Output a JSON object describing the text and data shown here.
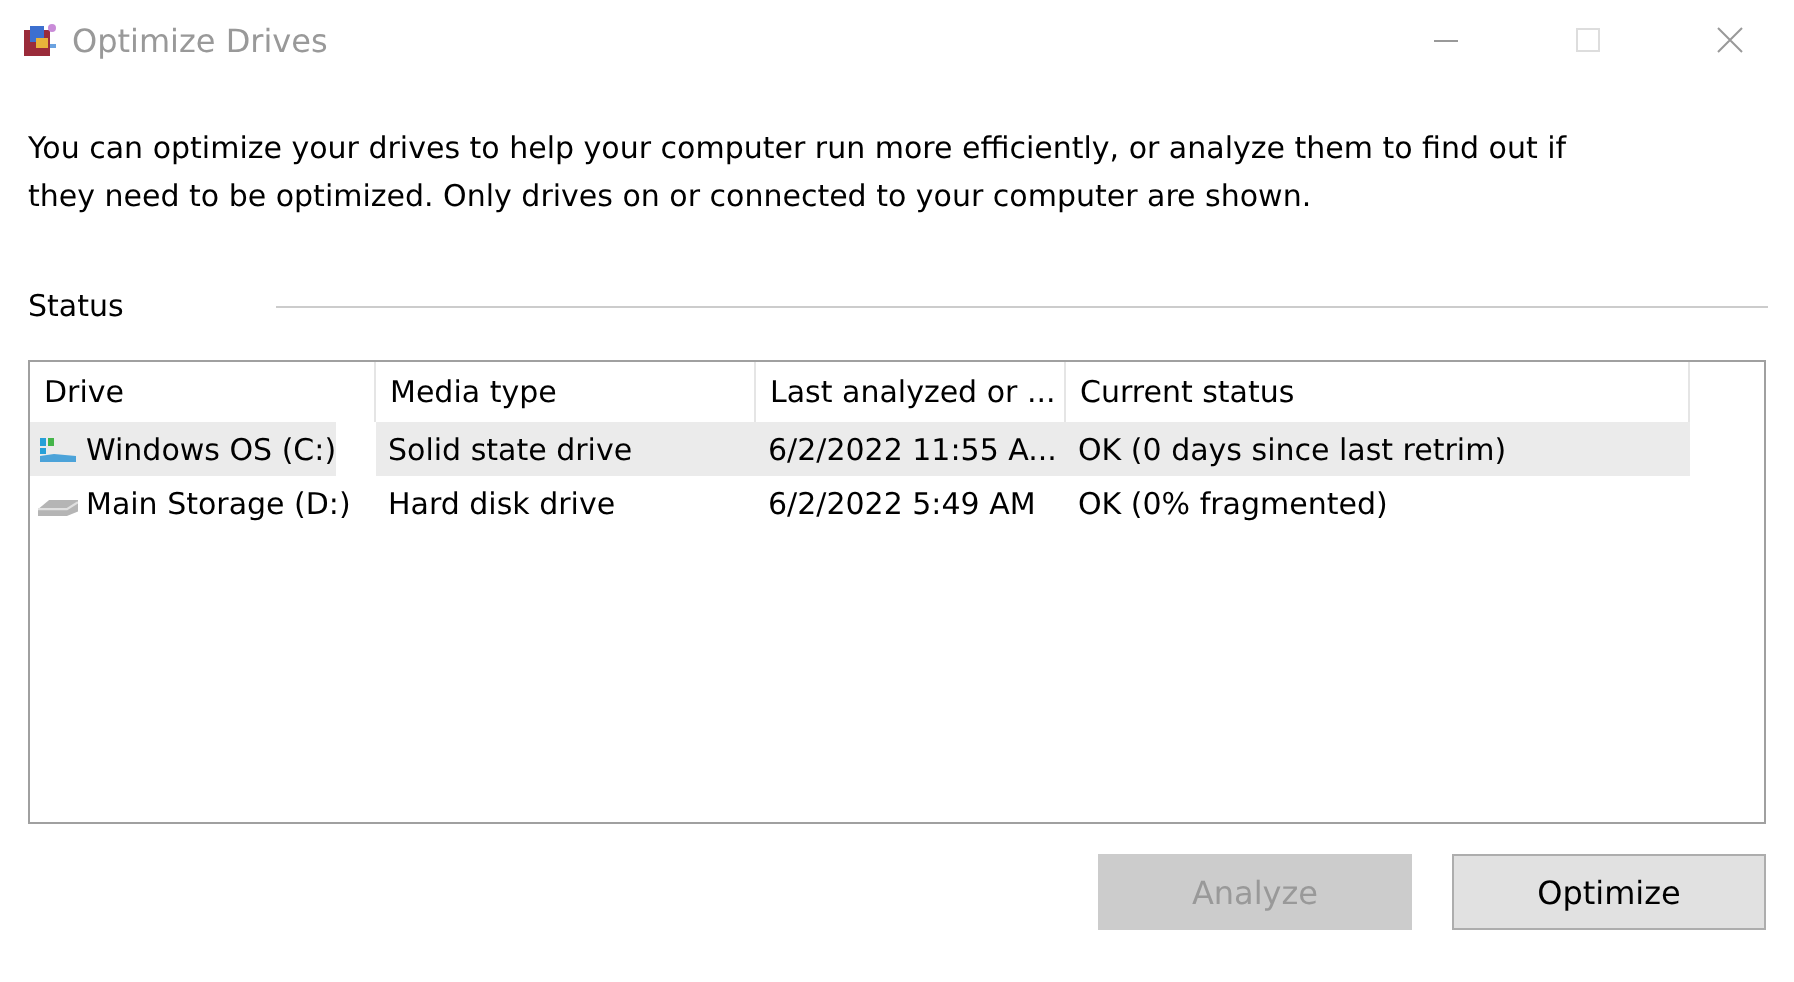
{
  "window": {
    "title": "Optimize Drives",
    "active": false
  },
  "description": "You can optimize your drives to help your computer run more efficiently, or analyze them to find out if they need to be optimized. Only drives on or connected to your computer are shown.",
  "status": {
    "label": "Status"
  },
  "table": {
    "columns": [
      "Drive",
      "Media type",
      "Last analyzed or ...",
      "Current status"
    ],
    "rows": [
      {
        "kind": "ssd",
        "drive": "Windows OS (C:)",
        "media_type": "Solid state drive",
        "last_analyzed": "6/2/2022 11:55 A...",
        "current_status": "OK (0 days since last retrim)",
        "selected": true
      },
      {
        "kind": "hdd",
        "drive": "Main Storage (D:)",
        "media_type": "Hard disk drive",
        "last_analyzed": "6/2/2022 5:49 AM",
        "current_status": "OK (0% fragmented)",
        "selected": false
      }
    ]
  },
  "buttons": [
    {
      "label": "Analyze",
      "disabled": true
    },
    {
      "label": "Optimize",
      "disabled": false
    }
  ]
}
